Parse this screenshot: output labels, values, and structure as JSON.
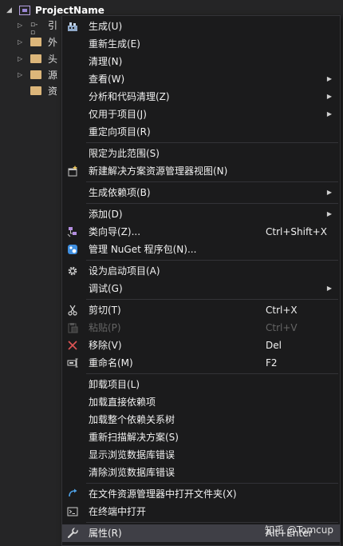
{
  "explorer": {
    "project_name": "ProjectName",
    "items": [
      {
        "label": "引",
        "icon": "reference-icon"
      },
      {
        "label": "外",
        "icon": "folder-icon"
      },
      {
        "label": "头",
        "icon": "folder-icon"
      },
      {
        "label": "源",
        "icon": "folder-icon"
      },
      {
        "label": "资",
        "icon": "folder-icon"
      }
    ]
  },
  "menu": {
    "items": [
      {
        "label": "生成(U)",
        "icon": "build-icon"
      },
      {
        "label": "重新生成(E)"
      },
      {
        "label": "清理(N)"
      },
      {
        "label": "查看(W)",
        "submenu": true
      },
      {
        "label": "分析和代码清理(Z)",
        "submenu": true
      },
      {
        "label": "仅用于项目(J)",
        "submenu": true
      },
      {
        "label": "重定向项目(R)"
      },
      {
        "label": "限定为此范围(S)"
      },
      {
        "label": "新建解决方案资源管理器视图(N)",
        "icon": "new-view-icon"
      },
      {
        "label": "生成依赖项(B)",
        "submenu": true
      },
      {
        "label": "添加(D)",
        "submenu": true
      },
      {
        "label": "类向导(Z)...",
        "icon": "class-wizard-icon",
        "shortcut": "Ctrl+Shift+X"
      },
      {
        "label": "管理 NuGet 程序包(N)...",
        "icon": "nuget-icon"
      },
      {
        "label": "设为启动项目(A)",
        "icon": "gear-icon"
      },
      {
        "label": "调试(G)",
        "submenu": true
      },
      {
        "label": "剪切(T)",
        "icon": "scissors-icon",
        "shortcut": "Ctrl+X"
      },
      {
        "label": "粘贴(P)",
        "icon": "paste-icon",
        "shortcut": "Ctrl+V",
        "disabled": true
      },
      {
        "label": "移除(V)",
        "icon": "remove-icon",
        "shortcut": "Del"
      },
      {
        "label": "重命名(M)",
        "icon": "rename-icon",
        "shortcut": "F2"
      },
      {
        "label": "卸载项目(L)"
      },
      {
        "label": "加载直接依赖项"
      },
      {
        "label": "加载整个依赖关系树"
      },
      {
        "label": "重新扫描解决方案(S)"
      },
      {
        "label": "显示浏览数据库错误"
      },
      {
        "label": "清除浏览数据库错误"
      },
      {
        "label": "在文件资源管理器中打开文件夹(X)",
        "icon": "open-folder-icon"
      },
      {
        "label": "在终端中打开",
        "icon": "terminal-icon"
      },
      {
        "label": "属性(R)",
        "icon": "wrench-icon",
        "shortcut": "Alt+Enter"
      }
    ]
  },
  "watermark": "知乎 @Tomcup",
  "colors": {
    "menu_bg": "#1b1b1c",
    "menu_border": "#333337",
    "highlight": "#3f3f46",
    "text": "#f1f1f1",
    "disabled_text": "#656565"
  }
}
